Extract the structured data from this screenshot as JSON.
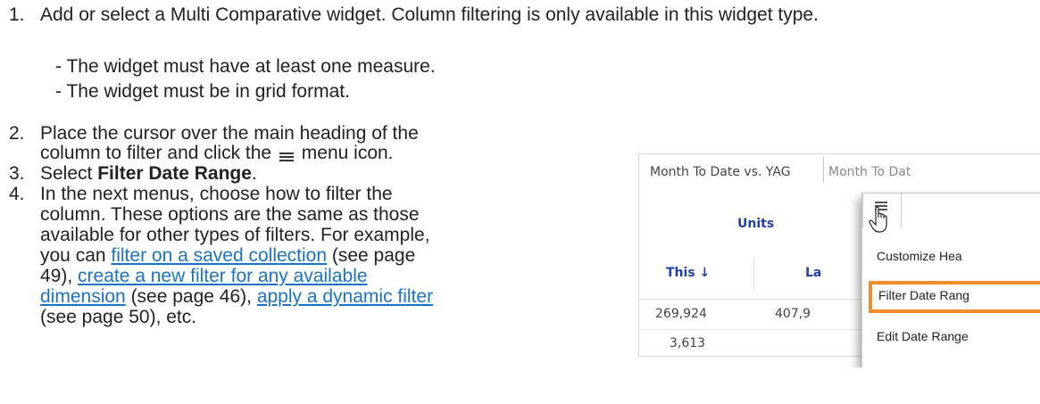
{
  "steps": [
    {
      "num": "1.",
      "text": "Add or select a Multi Comparative widget. Column filtering is only available in this widget type."
    },
    {
      "num": "2.",
      "line1": "Place the cursor over the main heading of the",
      "line2_pre": "column to filter and click the ",
      "line2_post": " menu icon."
    },
    {
      "num": "3.",
      "pre": "Select ",
      "bold": "Filter Date Range",
      "post": "."
    },
    {
      "num": "4.",
      "l1": "In the next menus, choose how to filter the",
      "l2": "column. These options are the same as those",
      "l3": "available for other types of filters. For example,",
      "l4_pre": "you can ",
      "link_saved": "filter on a saved collection",
      "l4_post": " (see page",
      "l5_pre": "49), ",
      "link_new_1": "create a new filter for any available",
      "link_new_2": "dimension",
      "l6_mid": " (see page 46), ",
      "link_dynamic": "apply a dynamic filter",
      "l7": "(see page 50), etc."
    }
  ],
  "requirements": [
    "- The widget must have at least one measure.",
    "- The widget must be in grid format."
  ],
  "screenshot": {
    "header1": "Month To Date vs. YAG",
    "header2": "Month To Dat",
    "subheader": "Units",
    "col_this": "This ↓",
    "col_last": "La",
    "row1_this": "269,924",
    "row1_last": "407,9",
    "row2_this": "3,613",
    "menu_items": [
      "Customize Hea",
      "Filter Date Rang",
      "Edit Date Range"
    ]
  },
  "icons": [
    "menu-icon",
    "hand-cursor-icon"
  ],
  "colors": {
    "link": "#1a73c9",
    "highlight": "#f08c2a",
    "header_blue": "#1f3fb0"
  }
}
